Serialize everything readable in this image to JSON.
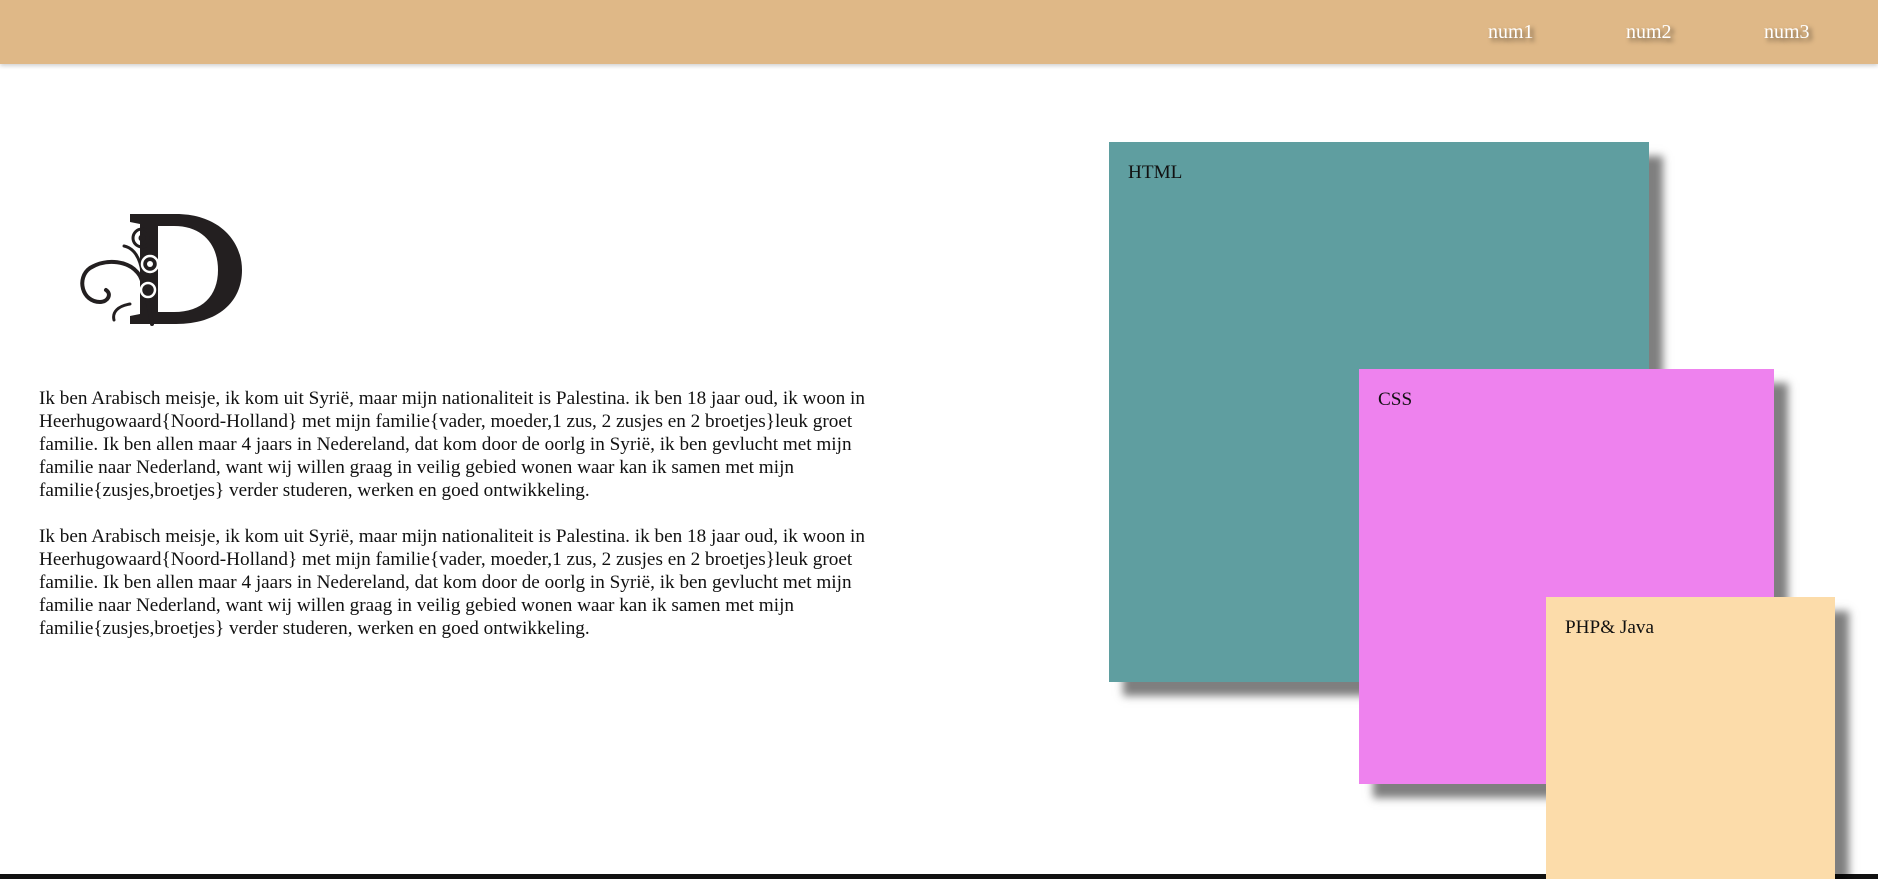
{
  "nav": {
    "links": [
      "num1",
      "num2",
      "num3"
    ]
  },
  "logo": {
    "icon": "ornamental-letter-d-logo",
    "letter": "D"
  },
  "content": {
    "paragraphs": [
      "Ik ben Arabisch meisje, ik kom uit Syrië, maar mijn nationaliteit is Palestina. ik ben 18 jaar oud, ik woon in Heerhugowaard{Noord-Holland} met mijn familie{vader, moeder,1 zus, 2 zusjes en 2 broetjes}leuk groet familie. Ik ben allen maar 4 jaars in Nedereland, dat kom door de oorlg in Syrië, ik ben gevlucht met mijn familie naar Nederland, want wij willen graag in veilig gebied wonen waar kan ik samen met mijn familie{zusjes,broetjes} verder studeren, werken en goed ontwikkeling.",
      "Ik ben Arabisch meisje, ik kom uit Syrië, maar mijn nationaliteit is Palestina. ik ben 18 jaar oud, ik woon in Heerhugowaard{Noord-Holland} met mijn familie{vader, moeder,1 zus, 2 zusjes en 2 broetjes}leuk groet familie. Ik ben allen maar 4 jaars in Nedereland, dat kom door de oorlg in Syrië, ik ben gevlucht met mijn familie naar Nederland, want wij willen graag in veilig gebied wonen waar kan ik samen met mijn familie{zusjes,broetjes} verder studeren, werken en goed ontwikkeling."
    ]
  },
  "boxes": [
    {
      "label": "HTML",
      "color": "#5f9ea0"
    },
    {
      "label": "CSS",
      "color": "#ee82ee"
    },
    {
      "label": "PHP& Java",
      "color": "#fcdcaa"
    }
  ],
  "colors": {
    "navbar": "#dfb887",
    "nav_text": "#ffffff",
    "background": "#ffffff"
  }
}
